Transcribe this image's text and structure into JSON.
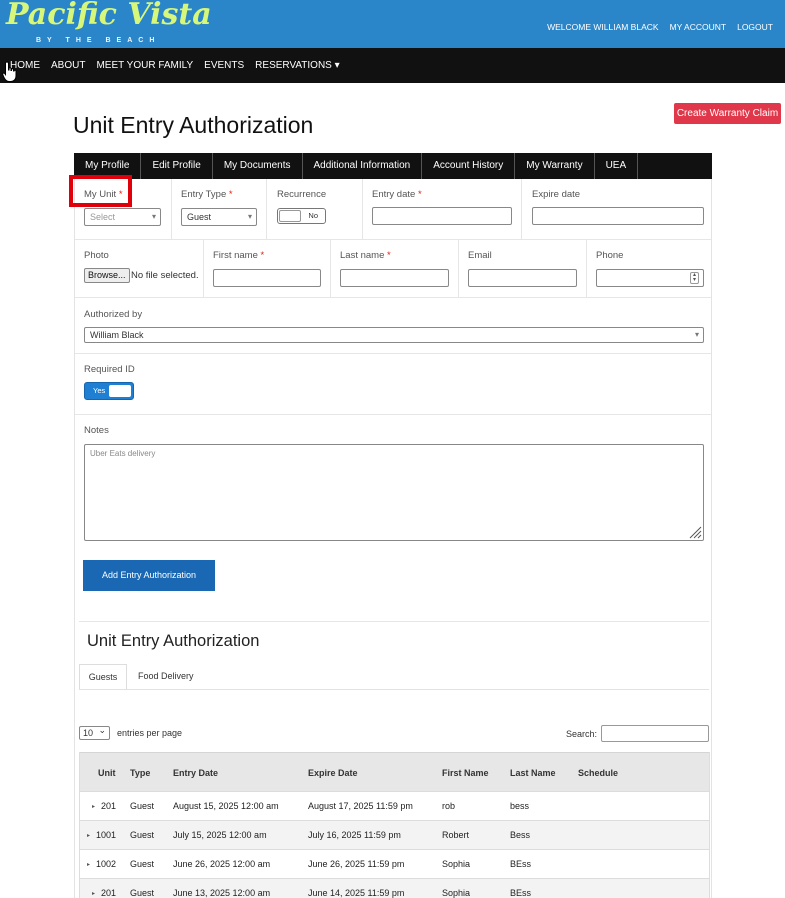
{
  "brand": {
    "name": "Pacific Vista",
    "tagline": "BY THE BEACH"
  },
  "header": {
    "welcome": "WELCOME WILLIAM BLACK",
    "account": "MY ACCOUNT",
    "logout": "LOGOUT"
  },
  "nav": {
    "items": [
      "HOME",
      "ABOUT",
      "MEET YOUR FAMILY",
      "EVENTS",
      "RESERVATIONS ▾"
    ],
    "cta": "Create Warranty Claim"
  },
  "page_title": "Unit Entry Authorization",
  "profile_tabs": [
    "My Profile",
    "Edit Profile",
    "My Documents",
    "Additional Information",
    "Account History",
    "My Warranty",
    "UEA"
  ],
  "form": {
    "my_unit": {
      "label": "My Unit",
      "placeholder": "Select"
    },
    "entry_type": {
      "label": "Entry Type",
      "value": "Guest"
    },
    "recurrence": {
      "label": "Recurrence",
      "value": "No"
    },
    "entry_date": {
      "label": "Entry date",
      "value": ""
    },
    "expire_date": {
      "label": "Expire date",
      "value": ""
    },
    "photo": {
      "label": "Photo",
      "button": "Browse...",
      "status": "No file selected."
    },
    "first_name": {
      "label": "First name"
    },
    "last_name": {
      "label": "Last name"
    },
    "email": {
      "label": "Email"
    },
    "phone": {
      "label": "Phone"
    },
    "authorized_by": {
      "label": "Authorized by",
      "value": "William Black"
    },
    "required_id": {
      "label": "Required ID",
      "value": "Yes"
    },
    "notes": {
      "label": "Notes",
      "placeholder": "Uber Eats delivery"
    },
    "required_mark": "*",
    "submit": "Add Entry Authorization"
  },
  "list": {
    "title": "Unit Entry Authorization",
    "tabs": [
      "Guests",
      "Food Delivery"
    ],
    "page_size": "10",
    "entries_label": "entries per page",
    "search_label": "Search:",
    "columns": [
      "Unit",
      "Type",
      "Entry Date",
      "Expire Date",
      "First Name",
      "Last Name",
      "Schedule"
    ],
    "rows": [
      [
        "201",
        "Guest",
        "August 15, 2025 12:00 am",
        "August 17, 2025 11:59 pm",
        "rob",
        "bess",
        ""
      ],
      [
        "1001",
        "Guest",
        "July 15, 2025 12:00 am",
        "July 16, 2025 11:59 pm",
        "Robert",
        "Bess",
        ""
      ],
      [
        "1002",
        "Guest",
        "June 26, 2025 12:00 am",
        "June 26, 2025 11:59 pm",
        "Sophia",
        "BEss",
        ""
      ],
      [
        "201",
        "Guest",
        "June 13, 2025 12:00 am",
        "June 14, 2025 11:59 pm",
        "Sophia",
        "BEss",
        ""
      ]
    ]
  },
  "colors": {
    "header_blue": "#2a86c9",
    "nav_black": "#111111",
    "cta_red": "#e0384a",
    "primary_blue": "#1a68b3",
    "highlight_red": "#e0000b"
  }
}
